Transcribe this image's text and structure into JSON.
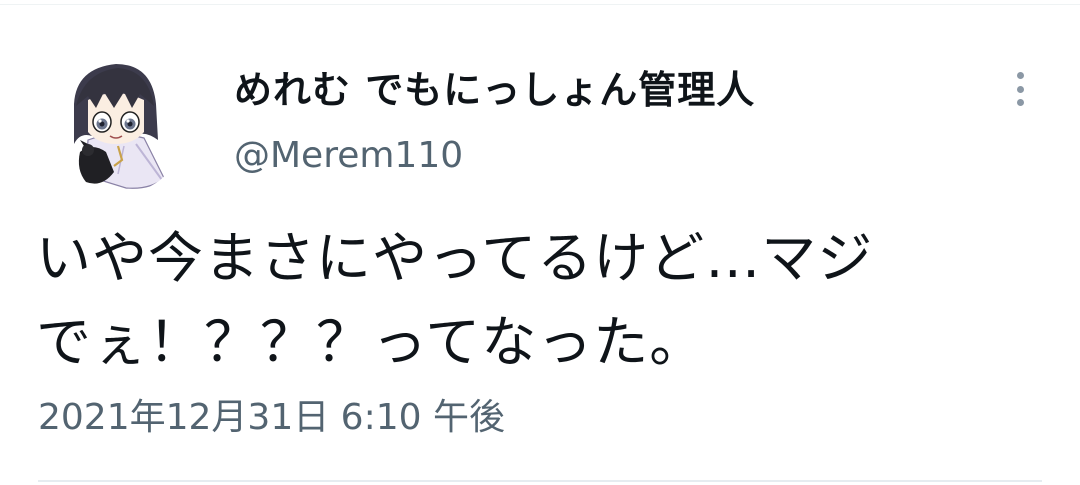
{
  "author": {
    "display_name": "めれむ でもにっしょん管理人",
    "handle": "@Merem110",
    "avatar_icon": "anime-character-avatar-icon"
  },
  "tweet": {
    "text_line1": "いや今まさにやってるけど…マジ",
    "text_line2": "でぇ！？？？ってなった。",
    "timestamp": "2021年12月31日 6:10 午後"
  },
  "menu": {
    "icon": "more-options-icon"
  },
  "colors": {
    "text_primary": "#0f1419",
    "text_secondary": "#536471",
    "menu_dots": "#8b98a5",
    "divider": "#e6ecf0"
  }
}
